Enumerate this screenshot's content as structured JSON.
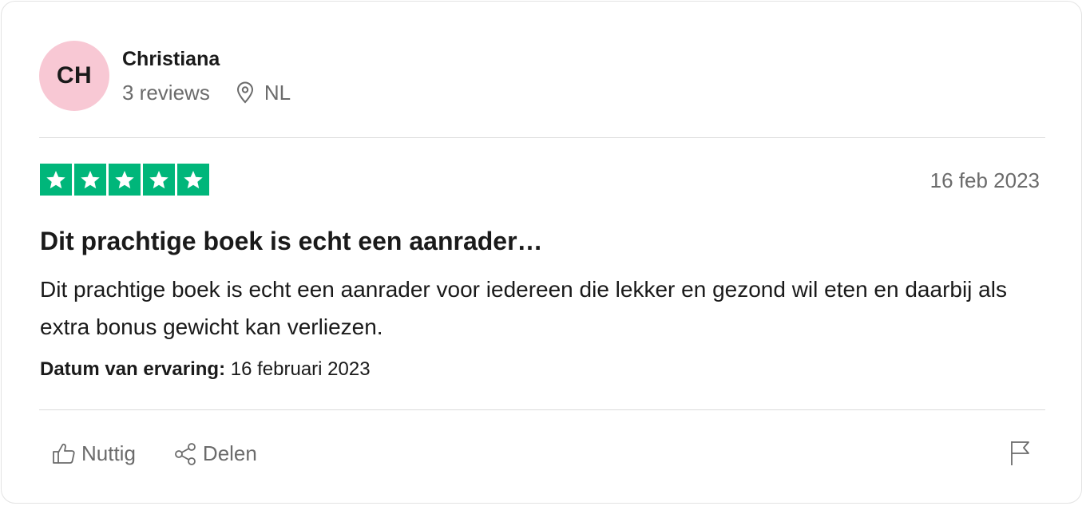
{
  "consumer": {
    "initials": "CH",
    "name": "Christiana",
    "review_count": "3 reviews",
    "location": "NL",
    "avatar_color": "#f8c8d4",
    "location_icon": "map-pin-icon"
  },
  "review": {
    "rating": 5,
    "max_rating": 5,
    "star_color": "#00b67a",
    "date": "16 feb 2023",
    "title": "Dit prachtige boek is echt een aanrader…",
    "text": "Dit prachtige boek is echt een aanrader voor iedereen die lekker en gezond wil eten en daarbij als extra bonus gewicht kan verliezen.",
    "experience_label": "Datum van ervaring:",
    "experience_date": "16 februari 2023"
  },
  "actions": {
    "useful_label": "Nuttig",
    "useful_icon": "thumbs-up-icon",
    "share_label": "Delen",
    "share_icon": "share-icon",
    "report_icon": "flag-icon"
  }
}
